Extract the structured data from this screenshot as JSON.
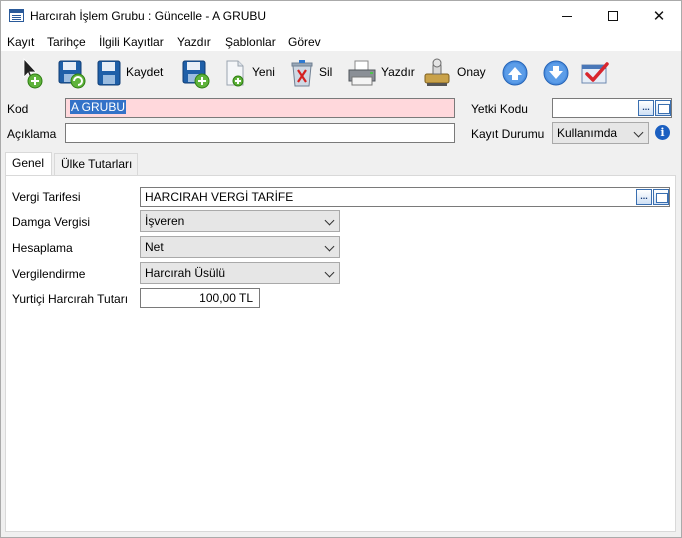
{
  "window": {
    "title": "Harcırah İşlem Grubu : Güncelle - A GRUBU"
  },
  "menu": [
    {
      "label": "Kayıt"
    },
    {
      "label": "Tarihçe"
    },
    {
      "label": "İlgili Kayıtlar"
    },
    {
      "label": "Yazdır"
    },
    {
      "label": "Şablonlar"
    },
    {
      "label": "Görev"
    }
  ],
  "toolbar": {
    "save_label": "Kaydet",
    "new_label": "Yeni",
    "delete_label": "Sil",
    "print_label": "Yazdır",
    "approve_label": "Onay"
  },
  "header": {
    "kod_label": "Kod",
    "kod_value": "A GRUBU",
    "aciklama_label": "Açıklama",
    "aciklama_value": "",
    "yetki_kodu_label": "Yetki Kodu",
    "yetki_kodu_value": "",
    "kayit_durumu_label": "Kayıt Durumu",
    "kayit_durumu_value": "Kullanımda",
    "lookup_dots": "..."
  },
  "tabs": [
    {
      "label": "Genel",
      "active": true
    },
    {
      "label": "Ülke Tutarları",
      "active": false
    }
  ],
  "genel": {
    "vergi_tarifesi_label": "Vergi Tarifesi",
    "vergi_tarifesi_value": "HARCIRAH VERGİ TARİFE",
    "damga_vergisi_label": "Damga Vergisi",
    "damga_vergisi_value": "İşveren",
    "hesaplama_label": "Hesaplama",
    "hesaplama_value": "Net",
    "vergilendirme_label": "Vergilendirme",
    "vergilendirme_value": "Harcırah Üsülü",
    "yurtici_label": "Yurtiçi Harcırah Tutarı",
    "yurtici_value": "100,00 TL"
  },
  "colors": {
    "required_field_bg": "#ffd8dc",
    "selection": "#3372c8",
    "accent_blue": "#1b5fc1"
  }
}
